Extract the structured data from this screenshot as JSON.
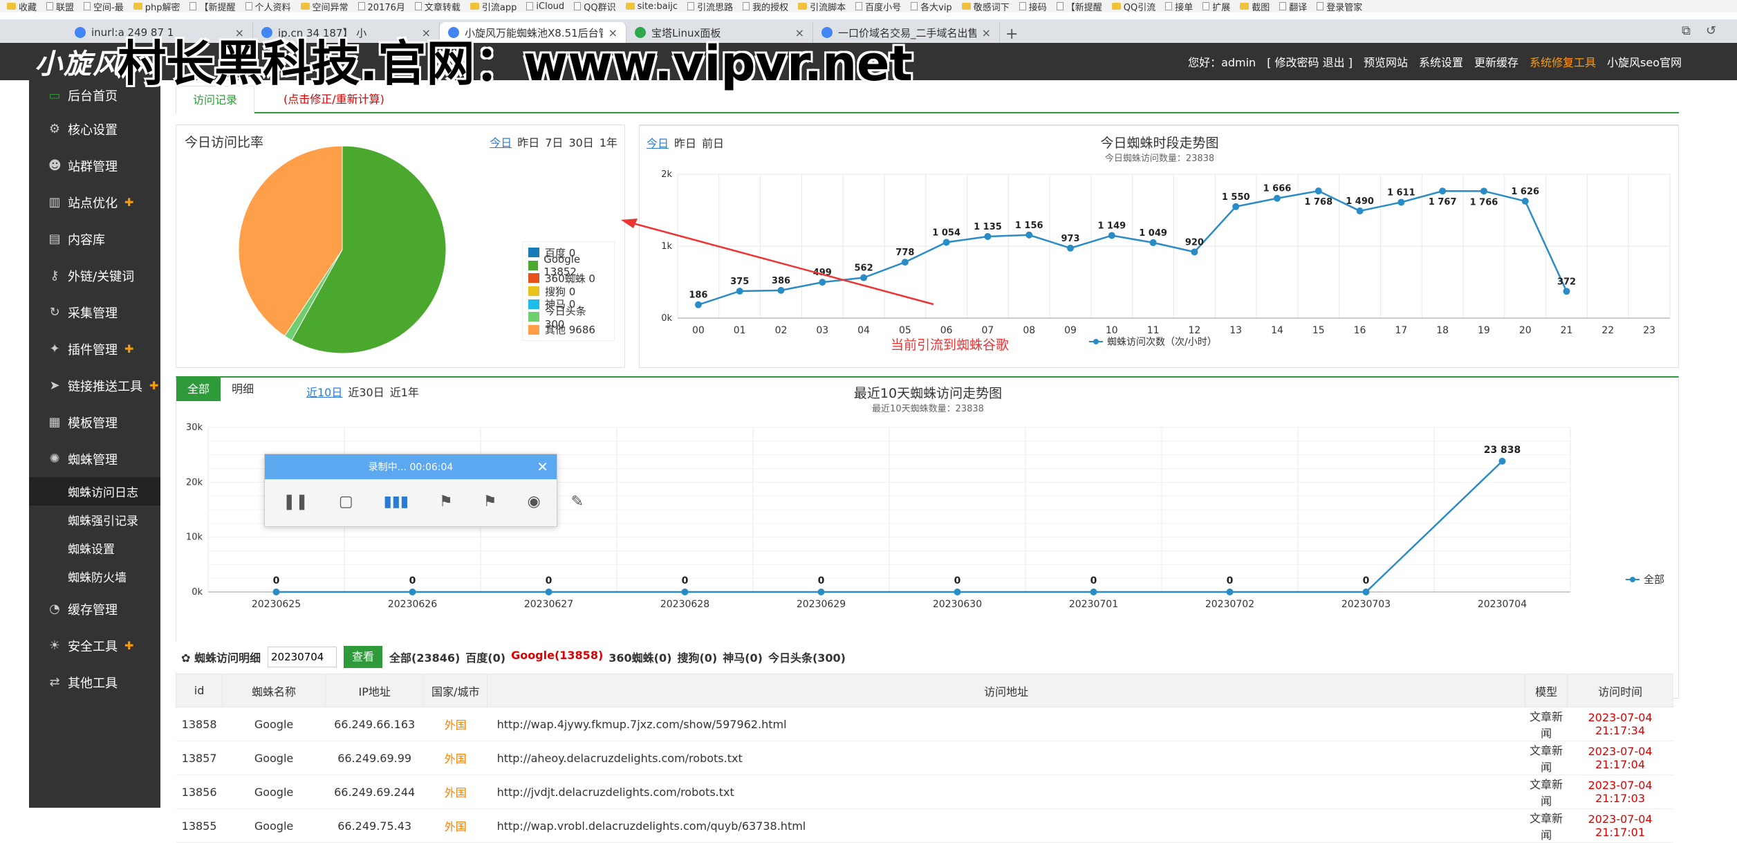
{
  "browser": {
    "bookmarks": [
      "收藏",
      "联盟",
      "空间-最",
      "php解密",
      "【新提醒",
      "个人资料",
      "空间异常",
      "20176月",
      "文章转载",
      "引流app",
      "iCloud",
      "QQ群识",
      "site:baijc",
      "引流思路",
      "我的授权",
      "引流脚本",
      "百度小号",
      "各大vip",
      "敬感词下",
      "接码",
      "【新提醒",
      "QQ引流",
      "接单",
      "扩展",
      "截图",
      "翻译",
      "登录管家"
    ],
    "tabs": [
      {
        "title": "inurl:a 249 87 1",
        "active": false
      },
      {
        "title": "ip.cn 34 187】 小",
        "active": false
      },
      {
        "title": "小旋风万能蜘蛛池X8.51后台管理",
        "active": true
      },
      {
        "title": "宝塔Linux面板",
        "active": false
      },
      {
        "title": "一口价域名交易_二手域名出售交",
        "active": false
      }
    ],
    "new_tab": "+"
  },
  "watermark": "村长黑科技.官网：www.vipvr.net",
  "header": {
    "logo": "小旋风",
    "links": [
      "您好：admin",
      "[ 修改密码 退出 ]",
      "预览网站",
      "系统设置",
      "更新缓存",
      "系统修复工具",
      "小旋风seo官网"
    ]
  },
  "sidebar": {
    "items": [
      {
        "label": "后台首页",
        "icon": "monitor-icon"
      },
      {
        "label": "核心设置",
        "icon": "gear-icon"
      },
      {
        "label": "站群管理",
        "icon": "user-icon"
      },
      {
        "label": "站点优化",
        "icon": "chart-icon"
      },
      {
        "label": "内容库",
        "icon": "doc-icon"
      },
      {
        "label": "外链/关键词",
        "icon": "key-icon"
      },
      {
        "label": "采集管理",
        "icon": "sync-icon"
      },
      {
        "label": "插件管理",
        "icon": "plugin-icon"
      },
      {
        "label": "链接推送工具",
        "icon": "send-icon"
      },
      {
        "label": "模板管理",
        "icon": "grid-icon"
      },
      {
        "label": "蜘蛛管理",
        "icon": "spider-icon"
      }
    ],
    "subitems": [
      "蜘蛛访问日志",
      "蜘蛛强引记录",
      "蜘蛛设置",
      "蜘蛛防火墙"
    ],
    "items2": [
      {
        "label": "缓存管理",
        "icon": "cache-icon"
      },
      {
        "label": "安全工具",
        "icon": "bulb-icon"
      },
      {
        "label": "其他工具",
        "icon": "shuffle-icon"
      }
    ]
  },
  "tabs": {
    "record": "访问记录",
    "fix": "(点击修正/重新计算)"
  },
  "pie": {
    "title": "今日访问比率",
    "ranges": [
      "今日",
      "昨日",
      "7日",
      "30日",
      "1年"
    ],
    "legend": [
      {
        "label": "百度 0",
        "color": "#1a7bb9"
      },
      {
        "label": "Google 13852",
        "color": "#4ba82e"
      },
      {
        "label": "360蜘蛛 0",
        "color": "#e8501d"
      },
      {
        "label": "搜狗 0",
        "color": "#e8c31d"
      },
      {
        "label": "神马 0",
        "color": "#1dbde8"
      },
      {
        "label": "今日头条 300",
        "color": "#6fcf6f"
      },
      {
        "label": "其他 9686",
        "color": "#ff9f4a"
      }
    ]
  },
  "hourly": {
    "ranges": [
      "今日",
      "昨日",
      "前日"
    ],
    "title": "今日蜘蛛时段走势图",
    "subtitle": "今日蜘蛛访问数量：23838",
    "legend": "蜘蛛访问次数（次/小时）"
  },
  "trend": {
    "tabs": [
      "全部",
      "明细"
    ],
    "ranges": [
      "近10日",
      "近30日",
      "近1年"
    ],
    "title": "最近10天蜘蛛访问走势图",
    "subtitle": "最近10天蜘蛛数量：23838",
    "legend": "全部"
  },
  "annotation": "当前引流到蜘蛛谷歌",
  "recorder": {
    "status": "录制中... 00:06:04"
  },
  "filter": {
    "label": "✿ 蜘蛛访问明细",
    "date": "20230704",
    "button": "查看",
    "stats": [
      "全部(23846)",
      "百度(0)",
      "Google(13858)",
      "360蜘蛛(0)",
      "搜狗(0)",
      "神马(0)",
      "今日头条(300)"
    ]
  },
  "table": {
    "headers": [
      "id",
      "蜘蛛名称",
      "IP地址",
      "国家/城市",
      "访问地址",
      "模型",
      "访问时间"
    ],
    "rows": [
      [
        "13858",
        "Google",
        "66.249.66.163",
        "外国",
        "http://wap.4jywy.fkmup.7jxz.com/show/597962.html",
        "文章新闻",
        "2023-07-04 21:17:34"
      ],
      [
        "13857",
        "Google",
        "66.249.69.99",
        "外国",
        "http://aheoy.delacruzdelights.com/robots.txt",
        "文章新闻",
        "2023-07-04 21:17:04"
      ],
      [
        "13856",
        "Google",
        "66.249.69.244",
        "外国",
        "http://jvdjt.delacruzdelights.com/robots.txt",
        "文章新闻",
        "2023-07-04 21:17:03"
      ],
      [
        "13855",
        "Google",
        "66.249.75.43",
        "外国",
        "http://wap.vrobl.delacruzdelights.com/quyb/63738.html",
        "文章新闻",
        "2023-07-04 21:17:01"
      ]
    ]
  },
  "chart_data": [
    {
      "type": "pie",
      "title": "今日访问比率",
      "categories": [
        "百度",
        "Google",
        "360蜘蛛",
        "搜狗",
        "神马",
        "今日头条",
        "其他"
      ],
      "values": [
        0,
        13852,
        0,
        0,
        0,
        300,
        9686
      ],
      "colors": [
        "#1a7bb9",
        "#4ba82e",
        "#e8501d",
        "#e8c31d",
        "#1dbde8",
        "#6fcf6f",
        "#ff9f4a"
      ]
    },
    {
      "type": "line",
      "title": "今日蜘蛛时段走势图",
      "x": [
        "00",
        "01",
        "02",
        "03",
        "04",
        "05",
        "06",
        "07",
        "08",
        "09",
        "10",
        "11",
        "12",
        "13",
        "14",
        "15",
        "16",
        "17",
        "18",
        "19",
        "20",
        "21",
        "22",
        "23"
      ],
      "series": [
        {
          "name": "蜘蛛访问次数（次/小时）",
          "values": [
            186,
            375,
            386,
            499,
            562,
            778,
            1054,
            1135,
            1156,
            973,
            1149,
            1049,
            920,
            1550,
            1666,
            1768,
            1490,
            1611,
            1767,
            1766,
            1626,
            372,
            null,
            null
          ]
        }
      ],
      "ylim": [
        0,
        2000
      ],
      "yticks": [
        "0k",
        "1k",
        "2k"
      ],
      "color": "#2a8cc6"
    },
    {
      "type": "line",
      "title": "最近10天蜘蛛访问走势图",
      "x": [
        "20230625",
        "20230626",
        "20230627",
        "20230628",
        "20230629",
        "20230630",
        "20230701",
        "20230702",
        "20230703",
        "20230704"
      ],
      "series": [
        {
          "name": "全部",
          "values": [
            0,
            0,
            0,
            0,
            0,
            0,
            0,
            0,
            0,
            23838
          ]
        }
      ],
      "labels": [
        "0",
        "0",
        "0",
        "0",
        "0",
        "0",
        "0",
        "0",
        "0",
        "23 838"
      ],
      "ylim": [
        0,
        30000
      ],
      "yticks": [
        "0k",
        "10k",
        "20k",
        "30k"
      ],
      "color": "#2a8cc6"
    }
  ]
}
